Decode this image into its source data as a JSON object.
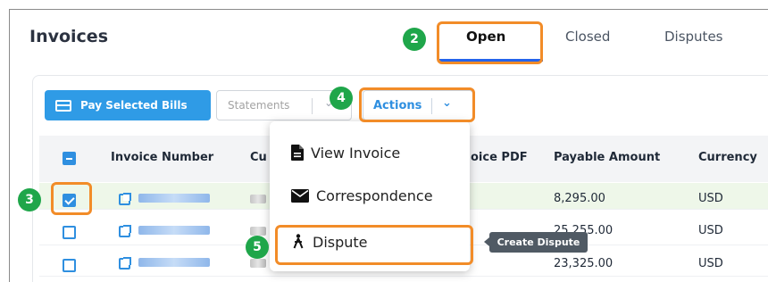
{
  "page": {
    "title": "Invoices"
  },
  "tabs": [
    {
      "label": "Open",
      "active": true
    },
    {
      "label": "Closed",
      "active": false
    },
    {
      "label": "Disputes",
      "active": false
    }
  ],
  "toolbar": {
    "pay_label": "Pay Selected Bills",
    "statements_label": "Statements",
    "actions_label": "Actions"
  },
  "table": {
    "headers": [
      "Invoice Number",
      "Cu",
      "oice PDF",
      "Payable Amount",
      "Currency"
    ],
    "rows": [
      {
        "checked": true,
        "amount": "8,295.00",
        "currency": "USD"
      },
      {
        "checked": false,
        "amount": "25,255.00",
        "currency": "USD"
      },
      {
        "checked": false,
        "amount": "23,325.00",
        "currency": "USD"
      }
    ]
  },
  "actions_menu": {
    "items": [
      {
        "label": "View Invoice",
        "icon": "document-icon"
      },
      {
        "label": "Correspondence",
        "icon": "envelope-icon"
      },
      {
        "label": "Dispute",
        "icon": "scissors-person-icon"
      }
    ]
  },
  "tooltip": {
    "text": "Create Dispute"
  },
  "callouts": {
    "step2": "2",
    "step3": "3",
    "step4": "4",
    "step5": "5"
  },
  "colors": {
    "accent": "#2f8fe0",
    "highlight": "#f28c28",
    "badge": "#1fa64a",
    "selected_row": "#eef7e9"
  }
}
